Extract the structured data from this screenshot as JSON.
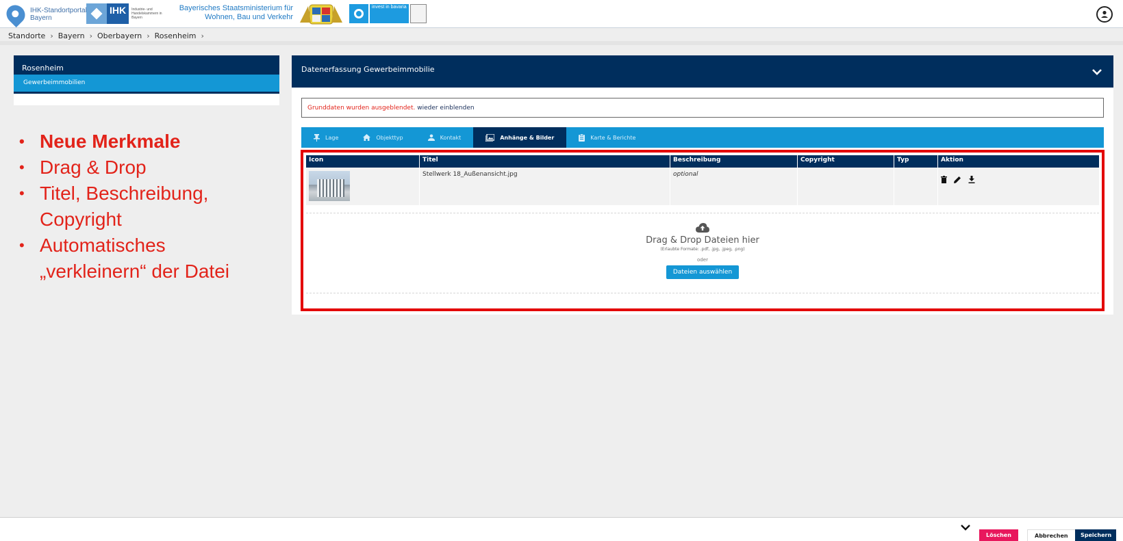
{
  "header": {
    "portal_line1": "IHK-Standortportal",
    "portal_line2": "Bayern",
    "ihk_logo": "IHK",
    "ihk_subtitle": "Industrie- und Handelskammern in Bayern",
    "ministry_line1": "Bayerisches Staatsministerium für",
    "ministry_line2": "Wohnen, Bau und Verkehr",
    "invest_logo": "invest in bavaria",
    "user_icon": "account-circle-icon"
  },
  "breadcrumb": [
    "Standorte",
    "Bayern",
    "Oberbayern",
    "Rosenheim"
  ],
  "sidebar": {
    "title": "Rosenheim",
    "items": [
      {
        "label": "Gewerbeimmobilien"
      }
    ]
  },
  "notes": [
    "Neue Merkmale",
    "Drag & Drop",
    "Titel, Beschreibung, Copyright",
    "Automatisches „verkleinern“ der Datei"
  ],
  "main": {
    "title": "Datenerfassung Gewerbeimmobilie",
    "info_message": "Grunddaten wurden ausgeblendet.",
    "info_link": "wieder einblenden",
    "tabs": [
      {
        "label": "Lage",
        "icon": "pin-icon"
      },
      {
        "label": "Objekttyp",
        "icon": "home-icon"
      },
      {
        "label": "Kontakt",
        "icon": "person-icon"
      },
      {
        "label": "Anhänge & Bilder",
        "icon": "images-icon",
        "active": true
      },
      {
        "label": "Karte & Berichte",
        "icon": "clipboard-icon"
      }
    ],
    "table": {
      "headers": [
        "Icon",
        "Titel",
        "Beschreibung",
        "Copyright",
        "Typ",
        "Aktion"
      ],
      "rows": [
        {
          "title": "Stellwerk 18_Außenansicht.jpg",
          "description": "optional",
          "copyright": "",
          "type": ""
        }
      ]
    },
    "dropzone": {
      "title": "Drag & Drop Dateien hier",
      "formats": "(Erlaubte Formate: .pdf, .jpg, .jpeg, .png)",
      "or": "oder",
      "button": "Dateien auswählen"
    }
  },
  "footer": {
    "delete": "Löschen",
    "cancel": "Abbrechen",
    "save": "Speichern"
  },
  "colors": {
    "navy": "#002e5d",
    "blue": "#1497d5",
    "red": "#e2231a",
    "pink": "#e8175d"
  }
}
